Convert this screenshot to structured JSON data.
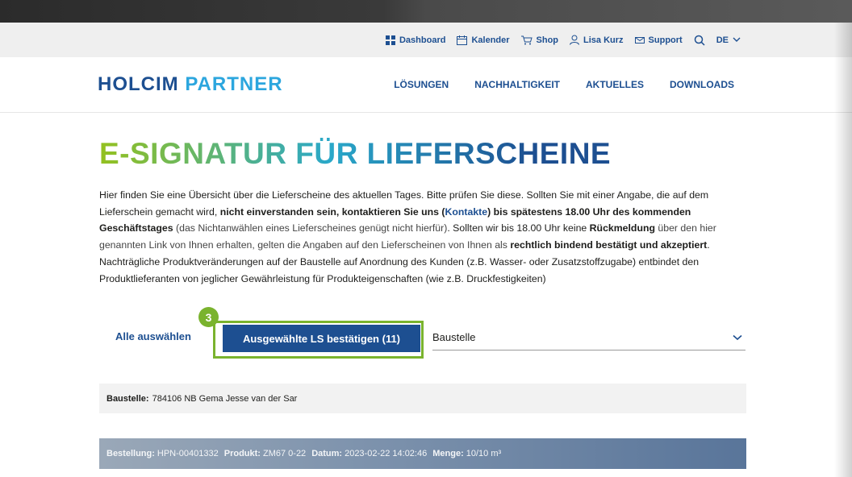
{
  "utility_nav": {
    "dashboard": "Dashboard",
    "calendar": "Kalender",
    "shop": "Shop",
    "user": "Lisa Kurz",
    "support": "Support",
    "language": "DE"
  },
  "brand": {
    "holcim": "HOLCIM",
    "partner": "PARTNER"
  },
  "main_nav": [
    "LÖSUNGEN",
    "NACHHALTIGKEIT",
    "AKTUELLES",
    "DOWNLOADS"
  ],
  "page": {
    "title": "E-SIGNATUR FÜR LIEFERSCHEINE",
    "intro": {
      "p1": "Hier finden Sie eine Übersicht über die Lieferscheine des aktuellen Tages. Bitte prüfen Sie diese. Sollten Sie mit einer Angabe, die auf dem Lieferschein gemacht wird, ",
      "b1": "nicht einverstanden sein, kontaktieren Sie uns (",
      "link": "Kontakte",
      "b2": ") bis spätestens 18.00 Uhr des kommenden Geschäftstages",
      "m1": " (das Nichtanwählen eines Lieferscheines genügt nicht hierfür)",
      "p2": ". Sollten wir bis 18.00 Uhr keine ",
      "b3": "Rückmeldung",
      "m2": " über den hier genannten Link von Ihnen erhalten, gelten die Angaben auf den Lieferscheinen von Ihnen als ",
      "b4": "rechtlich bindend bestätigt und akzeptiert",
      "p3": ". Nachträgliche Produktveränderungen auf der Baustelle auf Anordnung des Kunden (z.B. Wasser- oder Zusatzstoffzugabe) entbindet den Produktlieferanten von jeglicher Gewährleistung für Produkteigenschaften (wie z.B. Druckfestigkeiten)"
    }
  },
  "actions": {
    "step_number": "3",
    "select_all": "Alle auswählen",
    "confirm": "Ausgewählte LS bestätigen (11)",
    "site_select": "Baustelle"
  },
  "site_box": {
    "label": "Baustelle:",
    "value": "784106 NB Gema Jesse van der Sar"
  },
  "order": {
    "order_label": "Bestellung:",
    "order_value": "HPN-00401332",
    "product_label": "Produkt:",
    "product_value": "ZM67 0-22",
    "date_label": "Datum:",
    "date_value": "2023-02-22 14:02:46",
    "qty_label": "Menge:",
    "qty_value": "10/10 m³"
  },
  "colors": {
    "brand_blue": "#1d4f91",
    "brand_light_blue": "#2ca6de",
    "highlight_green": "#7ab32e"
  }
}
